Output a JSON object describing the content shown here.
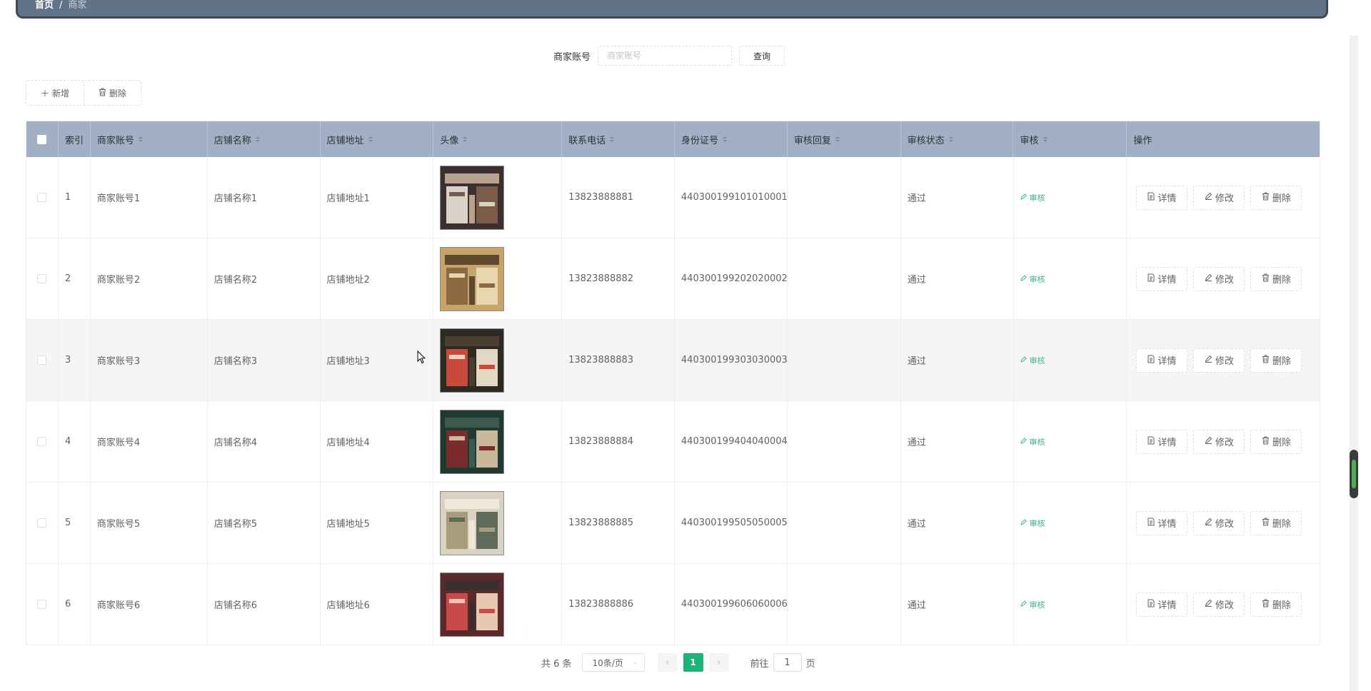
{
  "breadcrumb": {
    "home": "首页",
    "separator": "/",
    "current": "商家"
  },
  "search": {
    "label": "商家账号",
    "placeholder": "商家账号",
    "value": "",
    "button": "查询"
  },
  "toolbar": {
    "add": "新增",
    "delete": "删除"
  },
  "table": {
    "headers": [
      "索引",
      "商家账号",
      "店铺名称",
      "店铺地址",
      "头像",
      "联系电话",
      "身份证号",
      "审核回复",
      "审核状态",
      "审核",
      "操作"
    ],
    "rows": [
      {
        "index": "1",
        "account": "商家账号1",
        "name": "店铺名称1",
        "address": "店铺地址1",
        "phone": "13823888881",
        "idcard": "440300199101010001",
        "reply": "",
        "status": "通过",
        "audit": "审核"
      },
      {
        "index": "2",
        "account": "商家账号2",
        "name": "店铺名称2",
        "address": "店铺地址2",
        "phone": "13823888882",
        "idcard": "440300199202020002",
        "reply": "",
        "status": "通过",
        "audit": "审核"
      },
      {
        "index": "3",
        "account": "商家账号3",
        "name": "店铺名称3",
        "address": "店铺地址3",
        "phone": "13823888883",
        "idcard": "440300199303030003",
        "reply": "",
        "status": "通过",
        "audit": "审核"
      },
      {
        "index": "4",
        "account": "商家账号4",
        "name": "店铺名称4",
        "address": "店铺地址4",
        "phone": "13823888884",
        "idcard": "440300199404040004",
        "reply": "",
        "status": "通过",
        "audit": "审核"
      },
      {
        "index": "5",
        "account": "商家账号5",
        "name": "店铺名称5",
        "address": "店铺地址5",
        "phone": "13823888885",
        "idcard": "440300199505050005",
        "reply": "",
        "status": "通过",
        "audit": "审核"
      },
      {
        "index": "6",
        "account": "商家账号6",
        "name": "店铺名称6",
        "address": "店铺地址6",
        "phone": "13823888886",
        "idcard": "440300199606060006",
        "reply": "",
        "status": "通过",
        "audit": "审核"
      }
    ],
    "actions": {
      "detail": "详情",
      "edit": "修改",
      "delete": "删除"
    }
  },
  "pagination": {
    "total": "共 6 条",
    "page_size": "10条/页",
    "current_page": "1",
    "goto_label": "前往",
    "goto_value": "1",
    "goto_suffix": "页"
  },
  "colors": {
    "header_bar": "#627287",
    "table_head": "#a1b0c5",
    "accent": "#1fb27b",
    "audit_link": "#3db48c"
  },
  "icons": {
    "add": "plus-icon",
    "delete": "trash-icon",
    "detail": "document-icon",
    "edit": "pencil-icon",
    "audit": "pencil-icon",
    "prev": "chevron-left-icon",
    "next": "chevron-right-icon",
    "dropdown": "chevron-down-icon"
  }
}
